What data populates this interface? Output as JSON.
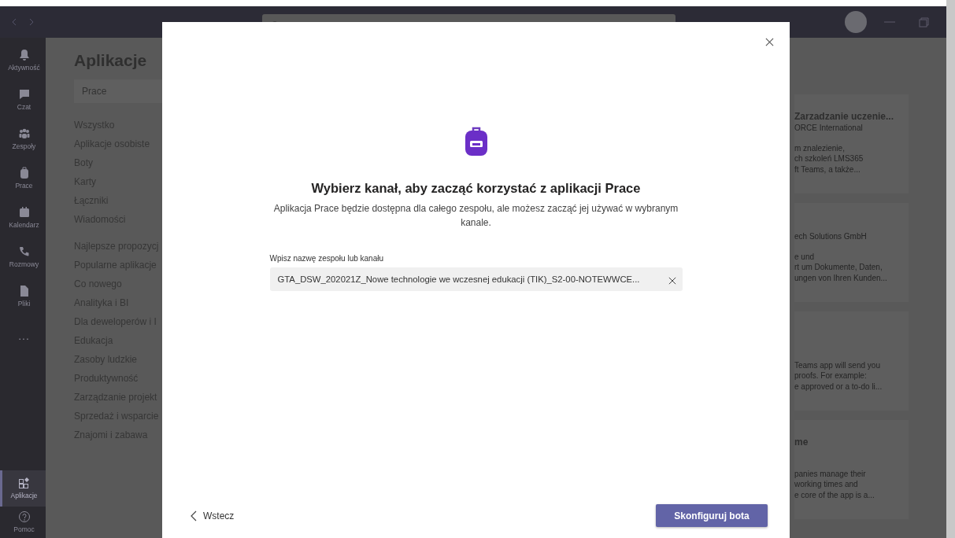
{
  "rail": [
    {
      "label": "Aktywność",
      "selected": false
    },
    {
      "label": "Czat",
      "selected": false
    },
    {
      "label": "Zespoły",
      "selected": false
    },
    {
      "label": "Prace",
      "selected": false
    },
    {
      "label": "Kalendarz",
      "selected": false
    },
    {
      "label": "Rozmowy",
      "selected": false
    },
    {
      "label": "Pliki",
      "selected": false
    },
    {
      "label": "...",
      "selected": false
    }
  ],
  "rail_bottom": [
    {
      "label": "Aplikacje",
      "selected": true
    },
    {
      "label": "Pomoc",
      "selected": false
    }
  ],
  "apps_panel": {
    "title": "Aplikacje",
    "search_value": "Prace",
    "groups": [
      [
        "Wszystko",
        "Aplikacje osobiste",
        "Boty",
        "Karty",
        "Łączniki",
        "Wiadomości"
      ],
      [
        "Najlepsze propozycj",
        "Popularne aplikacje",
        "Co nowego",
        "Analityka i BI",
        "Dla deweloperów i I",
        "Edukacja",
        "Zasoby ludzkie",
        "Produktywność",
        "Zarządzanie projekt",
        "Sprzedaż i wsparcie",
        "Znajomi i zabawa"
      ]
    ],
    "cards": [
      {
        "title": "Zarzadzanie uczenie...",
        "publisher": "ORCE International",
        "lines": [
          "m znalezienie,",
          "ch szkoleń LMS365",
          "ft Teams, a także..."
        ]
      },
      {
        "publisher": "ech Solutions GmbH",
        "lines": [
          "e und",
          "rt um Dokumente, Daten,",
          "ungen von Ihren Kunden..."
        ]
      },
      {
        "lines": [
          "Teams app will send you",
          "proofs. For example:",
          "e approved or a to-do li..."
        ]
      },
      {
        "title": "me",
        "lines": [
          "panies manage their",
          "working times and",
          "e core of the app is a..."
        ]
      }
    ]
  },
  "dialog": {
    "title": "Wybierz kanał, aby zacząć korzystać z aplikacji Prace",
    "subtitle": "Aplikacja Prace będzie dostępna dla całego zespołu, ale możesz zacząć jej używać w wybranym kanale.",
    "field_label": "Wpisz nazwę zespołu lub kanału",
    "field_value": "GTA_DSW_202021Z_Nowe technologie we wczesnej edukacji (TIK)_S2-00-NOTEWWCE...",
    "back": "Wstecz",
    "primary": "Skonfiguruj bota"
  }
}
